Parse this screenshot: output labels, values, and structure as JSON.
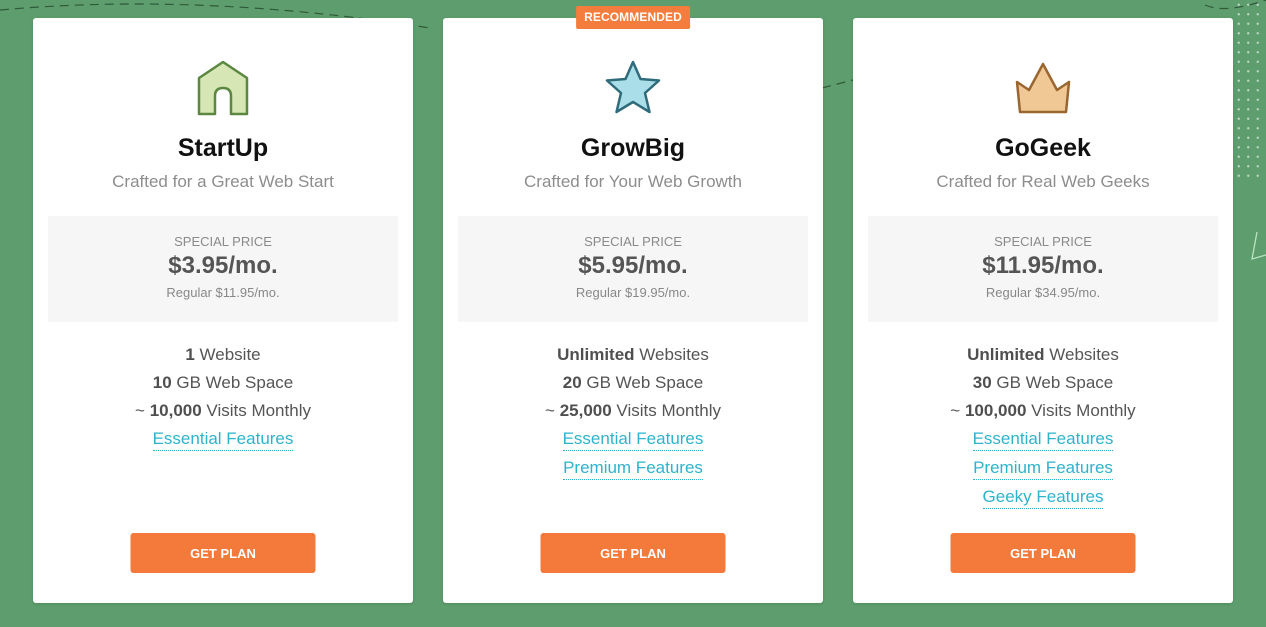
{
  "badge": {
    "label": "RECOMMENDED"
  },
  "colors": {
    "background": "#5e9e6e",
    "accent_button": "#f47a3c",
    "link": "#2fb3cc",
    "price_box": "#f6f6f6"
  },
  "plans": [
    {
      "icon": "house-icon",
      "name": "StartUp",
      "tagline": "Crafted for a Great Web Start",
      "price_label": "SPECIAL PRICE",
      "price": "$3.95/mo.",
      "regular": "Regular $11.95/mo.",
      "features": [
        {
          "bold": "1",
          "text": " Website"
        },
        {
          "bold": "10",
          "text": " GB Web Space"
        },
        {
          "prefix": "~ ",
          "bold": "10,000",
          "text": " Visits Monthly"
        }
      ],
      "links": [
        "Essential Features"
      ],
      "button": "GET PLAN"
    },
    {
      "icon": "star-icon",
      "name": "GrowBig",
      "tagline": "Crafted for Your Web Growth",
      "price_label": "SPECIAL PRICE",
      "price": "$5.95/mo.",
      "regular": "Regular $19.95/mo.",
      "features": [
        {
          "bold": "Unlimited",
          "text": " Websites"
        },
        {
          "bold": "20",
          "text": " GB Web Space"
        },
        {
          "prefix": "~ ",
          "bold": "25,000",
          "text": " Visits Monthly"
        }
      ],
      "links": [
        "Essential Features",
        "Premium Features"
      ],
      "button": "GET PLAN"
    },
    {
      "icon": "crown-icon",
      "name": "GoGeek",
      "tagline": "Crafted for Real Web Geeks",
      "price_label": "SPECIAL PRICE",
      "price": "$11.95/mo.",
      "regular": "Regular $34.95/mo.",
      "features": [
        {
          "bold": "Unlimited",
          "text": " Websites"
        },
        {
          "bold": "30",
          "text": " GB Web Space"
        },
        {
          "prefix": "~ ",
          "bold": "100,000",
          "text": " Visits Monthly"
        }
      ],
      "links": [
        "Essential Features",
        "Premium Features",
        "Geeky Features"
      ],
      "button": "GET PLAN"
    }
  ]
}
